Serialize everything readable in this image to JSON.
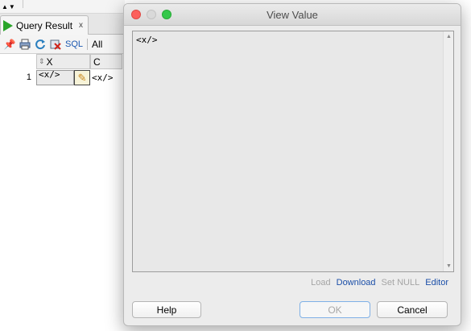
{
  "background": {
    "top_arrows": "▲▼",
    "tab": {
      "label": "Query Result",
      "close": "x"
    },
    "toolbar": {
      "sql_label": "SQL",
      "all_label": "All"
    },
    "grid": {
      "columns": [
        "X",
        "C"
      ],
      "rows": [
        {
          "num": "1",
          "x": "<x/>",
          "c": "<x/>"
        }
      ]
    }
  },
  "dialog": {
    "title": "View Value",
    "content": "<x/>",
    "links": {
      "load": "Load",
      "download": "Download",
      "set_null": "Set NULL",
      "editor": "Editor"
    },
    "buttons": {
      "help": "Help",
      "ok": "OK",
      "cancel": "Cancel"
    }
  },
  "colors": {
    "run_green": "#2aa52a",
    "link_blue": "#1a4ea8",
    "close_red": "#fc605c",
    "max_green": "#34c84a"
  }
}
